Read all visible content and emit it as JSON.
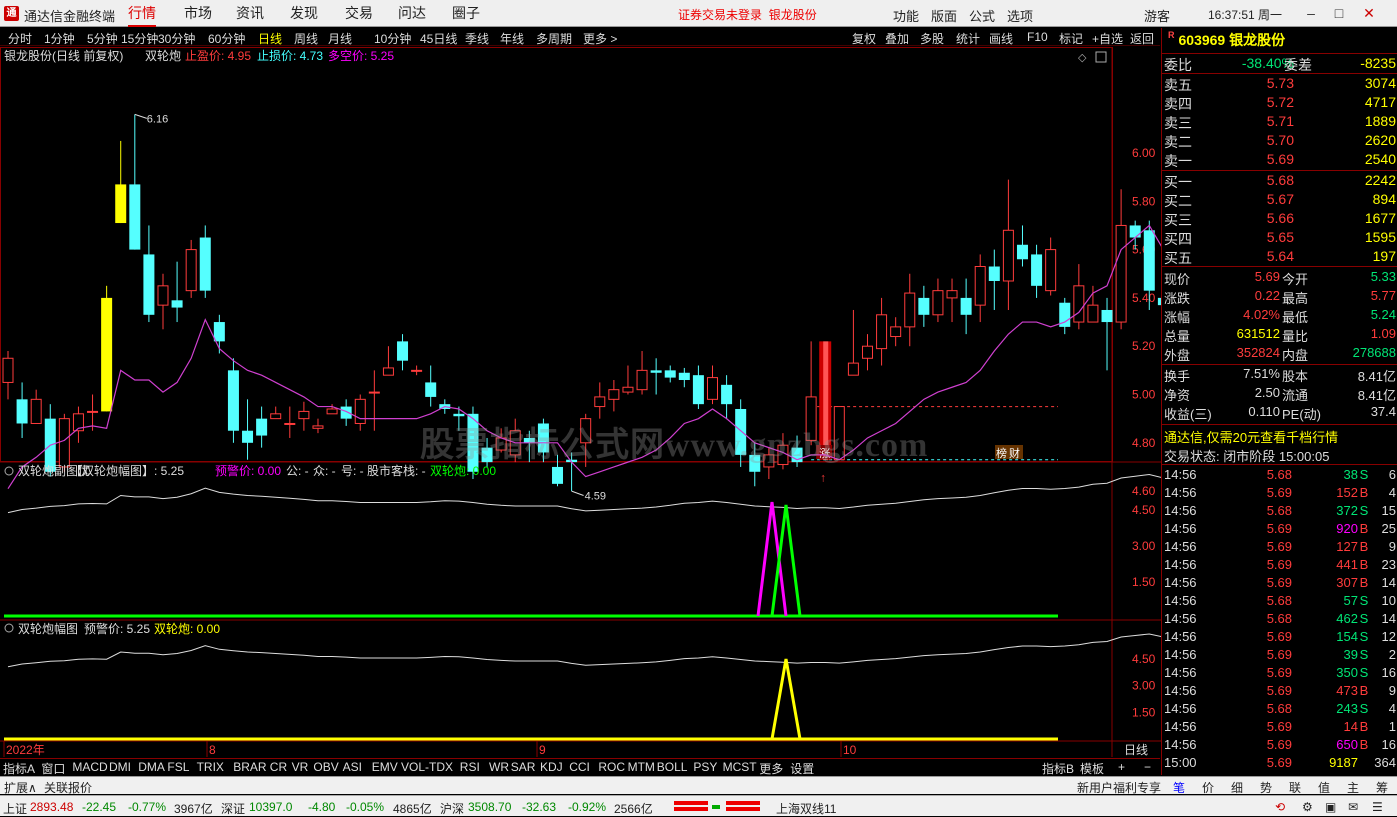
{
  "titlebar": {
    "app": "通达信金融终端",
    "menus": [
      "行情",
      "市场",
      "资讯",
      "发现",
      "交易",
      "问达",
      "圈子"
    ],
    "active": "行情",
    "notice": "证券交易未登录",
    "notice_stock": "银龙股份",
    "right_menus": [
      "功能",
      "版面",
      "公式",
      "选项"
    ],
    "user": "游客",
    "clock": "16:37:51 周一",
    "win_buttons": [
      "–",
      "□",
      "✕"
    ]
  },
  "toolbar": {
    "periods": [
      "分时",
      "1分钟",
      "5分钟",
      "15分钟",
      "30分钟",
      "60分钟",
      "日线",
      "周线",
      "月线",
      "10分钟",
      "45日线",
      "季线",
      "年线",
      "多周期",
      "更多 >"
    ],
    "active_period": "日线",
    "buttons": [
      "复权",
      "叠加",
      "多股",
      "统计",
      "画线",
      "F10",
      "标记",
      "+自选",
      "返回"
    ]
  },
  "main_chart": {
    "title": "银龙股份(日线 前复权)",
    "indicator": "双轮炮",
    "stop_profit_label": "止盈价: 4.95",
    "stop_loss_label": "止损价: 4.73",
    "long_short_label": "多空价: 5.25",
    "high_marker": "6.16",
    "low_marker": "4.59",
    "badge_zhang": "涨",
    "badge_bang": "榜",
    "badge_cai": "财",
    "watermark": "股票指标公式网www.gpzbgs.com",
    "y_labels": [
      "6.00",
      "5.80",
      "5.60",
      "5.40",
      "5.20",
      "5.00",
      "4.80",
      "4.60"
    ],
    "candles": [
      [
        5.05,
        5.15,
        4.98,
        5.18
      ],
      [
        4.98,
        4.88,
        4.82,
        5.05
      ],
      [
        4.88,
        4.98,
        4.9,
        5.02
      ],
      [
        4.9,
        4.68,
        4.66,
        4.96
      ],
      [
        4.7,
        4.9,
        4.68,
        4.92
      ],
      [
        4.85,
        4.92,
        4.8,
        4.95
      ],
      [
        4.93,
        4.93,
        4.85,
        5.0
      ],
      [
        4.93,
        5.4,
        4.93,
        5.45
      ],
      [
        5.71,
        5.87,
        5.71,
        6.05
      ],
      [
        5.87,
        5.6,
        5.6,
        6.16
      ],
      [
        5.58,
        5.33,
        5.3,
        5.7
      ],
      [
        5.37,
        5.45,
        5.27,
        5.5
      ],
      [
        5.39,
        5.36,
        5.3,
        5.55
      ],
      [
        5.43,
        5.6,
        5.4,
        5.64
      ],
      [
        5.65,
        5.43,
        5.4,
        5.7
      ],
      [
        5.3,
        5.22,
        5.17,
        5.33
      ],
      [
        5.1,
        4.85,
        4.8,
        5.15
      ],
      [
        4.85,
        4.8,
        4.73,
        4.98
      ],
      [
        4.9,
        4.83,
        4.78,
        4.95
      ],
      [
        4.9,
        4.92,
        4.9,
        4.95
      ],
      [
        4.88,
        4.88,
        4.82,
        4.95
      ],
      [
        4.9,
        4.93,
        4.85,
        4.97
      ],
      [
        4.86,
        4.87,
        4.84,
        4.9
      ],
      [
        4.92,
        4.94,
        4.92,
        4.96
      ],
      [
        4.95,
        4.9,
        4.87,
        4.98
      ],
      [
        4.88,
        4.98,
        4.85,
        5.0
      ],
      [
        5.01,
        5.01,
        4.85,
        5.1
      ],
      [
        5.08,
        5.11,
        5.08,
        5.2
      ],
      [
        5.22,
        5.14,
        5.1,
        5.25
      ],
      [
        5.1,
        5.1,
        5.08,
        5.12
      ],
      [
        5.05,
        4.99,
        4.95,
        5.12
      ],
      [
        4.96,
        4.94,
        4.92,
        4.98
      ],
      [
        4.92,
        4.91,
        4.85,
        4.95
      ],
      [
        4.92,
        4.68,
        4.65,
        4.95
      ],
      [
        4.78,
        4.72,
        4.7,
        4.82
      ],
      [
        4.77,
        4.82,
        4.76,
        4.86
      ],
      [
        4.75,
        4.85,
        4.72,
        4.9
      ],
      [
        4.82,
        4.8,
        4.72,
        4.85
      ],
      [
        4.88,
        4.76,
        4.72,
        4.9
      ],
      [
        4.7,
        4.63,
        4.62,
        4.75
      ],
      [
        4.73,
        4.72,
        4.6,
        4.76
      ],
      [
        4.8,
        4.9,
        4.7,
        4.92
      ],
      [
        4.95,
        4.99,
        4.9,
        5.05
      ],
      [
        4.98,
        5.02,
        4.93,
        5.06
      ],
      [
        5.01,
        5.03,
        5.0,
        5.12
      ],
      [
        5.02,
        5.1,
        5.0,
        5.18
      ],
      [
        5.1,
        5.09,
        5.0,
        5.15
      ],
      [
        5.1,
        5.07,
        5.05,
        5.12
      ],
      [
        5.09,
        5.06,
        5.03,
        5.11
      ],
      [
        5.08,
        4.96,
        4.94,
        5.12
      ],
      [
        4.98,
        5.07,
        4.96,
        5.12
      ],
      [
        5.04,
        4.96,
        4.9,
        5.08
      ],
      [
        4.94,
        4.75,
        4.7,
        4.98
      ],
      [
        4.75,
        4.68,
        4.62,
        4.8
      ],
      [
        4.7,
        4.75,
        4.65,
        4.78
      ],
      [
        4.71,
        4.79,
        4.69,
        4.84
      ],
      [
        4.78,
        4.72,
        4.7,
        4.83
      ],
      [
        4.81,
        4.99,
        4.79,
        5.22
      ],
      [
        4.93,
        4.83,
        4.73,
        4.96
      ],
      [
        4.73,
        4.95,
        4.73,
        4.95
      ],
      [
        5.08,
        5.13,
        5.08,
        5.35
      ],
      [
        5.15,
        5.2,
        5.1,
        5.25
      ],
      [
        5.19,
        5.33,
        5.12,
        5.4
      ],
      [
        5.24,
        5.28,
        5.2,
        5.32
      ],
      [
        5.28,
        5.42,
        5.2,
        5.5
      ],
      [
        5.4,
        5.33,
        5.28,
        5.45
      ],
      [
        5.33,
        5.43,
        5.3,
        5.48
      ],
      [
        5.4,
        5.43,
        5.3,
        5.48
      ],
      [
        5.4,
        5.33,
        5.25,
        5.48
      ],
      [
        5.37,
        5.53,
        5.3,
        5.58
      ],
      [
        5.53,
        5.47,
        5.35,
        5.6
      ],
      [
        5.47,
        5.68,
        5.35,
        5.89
      ],
      [
        5.62,
        5.56,
        5.53,
        5.7
      ],
      [
        5.58,
        5.45,
        5.4,
        5.62
      ],
      [
        5.43,
        5.6,
        5.41,
        5.65
      ],
      [
        5.38,
        5.28,
        5.25,
        5.4
      ],
      [
        5.3,
        5.45,
        5.27,
        5.54
      ],
      [
        5.3,
        5.37,
        5.32,
        5.45
      ],
      [
        5.35,
        5.3,
        5.1,
        5.4
      ],
      [
        5.3,
        5.7,
        5.27,
        5.85
      ],
      [
        5.7,
        5.65,
        5.6,
        5.72
      ],
      [
        5.68,
        5.43,
        5.35,
        5.72
      ],
      [
        5.4,
        5.37,
        5.3,
        5.85
      ],
      [
        5.3,
        5.32,
        5.28,
        5.45
      ],
      [
        5.33,
        5.68,
        5.25,
        5.77
      ]
    ],
    "line": [
      4.61,
      4.7,
      4.74,
      4.79,
      4.81,
      4.86,
      4.87,
      4.86,
      5.1,
      5.06,
      5.06,
      5.01,
      5.05,
      5.15,
      5.31,
      5.19,
      5.14,
      5.1,
      5.08,
      5.05,
      5.02,
      4.99,
      4.95,
      4.95,
      4.93,
      4.9,
      4.9,
      4.9,
      4.9,
      4.9,
      4.92,
      4.95,
      4.94,
      4.9,
      4.85,
      4.82,
      4.8,
      4.8,
      4.8,
      4.8,
      4.72,
      4.66,
      4.68,
      4.7,
      4.72,
      4.74,
      4.77,
      4.82,
      4.88,
      4.9,
      4.94,
      4.9,
      4.85,
      4.8,
      4.78,
      4.76,
      4.73,
      4.75,
      4.75,
      4.73,
      4.77,
      4.82,
      4.85,
      4.88,
      4.93,
      4.98,
      5.01,
      5.03,
      5.05,
      5.1,
      5.18,
      5.25,
      5.3,
      5.3,
      5.28,
      5.3,
      5.34,
      5.42,
      5.45,
      5.6,
      5.65,
      5.7,
      5.6,
      5.28,
      5.26,
      5.26
    ],
    "stop_profit_line": 4.95,
    "stop_loss_line": 4.73
  },
  "sub1": {
    "title": "双轮炮副图优",
    "formula": "【双轮炮幅图】: 5.25",
    "warn": "预警价: 0.00",
    "public": "公: -",
    "crowd": "众: -",
    "num": "号: -",
    "stock": "股市客栈: -",
    "dlp": "双轮炮: 0.00",
    "y_labels": [
      "4.50",
      "3.00",
      "1.50"
    ]
  },
  "sub2": {
    "title": "双轮炮幅图",
    "warn": "预警价: 5.25",
    "dlp": "双轮炮: 0.00",
    "y_labels": [
      "4.50",
      "3.00",
      "1.50"
    ],
    "x_labels": [
      "2022年",
      "8",
      "9",
      "10"
    ],
    "period_label": "日线"
  },
  "right_panel": {
    "code": "603969",
    "name": "银龙股份",
    "wb_label": "委比",
    "wb": "-38.40%",
    "wc_label": "委差",
    "wc": "-8235",
    "asks": [
      {
        "l": "卖五",
        "p": "5.73",
        "v": "3074"
      },
      {
        "l": "卖四",
        "p": "5.72",
        "v": "4717"
      },
      {
        "l": "卖三",
        "p": "5.71",
        "v": "1889"
      },
      {
        "l": "卖二",
        "p": "5.70",
        "v": "2620"
      },
      {
        "l": "卖一",
        "p": "5.69",
        "v": "2540"
      }
    ],
    "bids": [
      {
        "l": "买一",
        "p": "5.68",
        "v": "2242"
      },
      {
        "l": "买二",
        "p": "5.67",
        "v": "894"
      },
      {
        "l": "买三",
        "p": "5.66",
        "v": "1677"
      },
      {
        "l": "买四",
        "p": "5.65",
        "v": "1595"
      },
      {
        "l": "买五",
        "p": "5.64",
        "v": "197"
      }
    ],
    "quote": [
      {
        "k1": "现价",
        "v1": "5.69",
        "c1": "red",
        "k2": "今开",
        "v2": "5.33",
        "c2": "grn"
      },
      {
        "k1": "涨跌",
        "v1": "0.22",
        "c1": "red",
        "k2": "最高",
        "v2": "5.77",
        "c2": "red"
      },
      {
        "k1": "涨幅",
        "v1": "4.02%",
        "c1": "red",
        "k2": "最低",
        "v2": "5.24",
        "c2": "grn"
      },
      {
        "k1": "总量",
        "v1": "631512",
        "c1": "yel",
        "k2": "量比",
        "v2": "1.09",
        "c2": "red"
      },
      {
        "k1": "外盘",
        "v1": "352824",
        "c1": "red",
        "k2": "内盘",
        "v2": "278688",
        "c2": "grn"
      }
    ],
    "quote2": [
      {
        "k1": "换手",
        "v1": "7.51%",
        "k2": "股本",
        "v2": "8.41亿"
      },
      {
        "k1": "净资",
        "v1": "2.50",
        "k2": "流通",
        "v2": "8.41亿"
      },
      {
        "k1": "收益(三)",
        "v1": "0.110",
        "k2": "PE(动)",
        "v2": "37.4"
      }
    ],
    "promo": "通达信,仅需20元查看千档行情",
    "state": "交易状态: 闭市阶段 15:00:05",
    "ticks": [
      [
        "14:56",
        "5.68",
        "38",
        "S",
        "6"
      ],
      [
        "14:56",
        "5.69",
        "152",
        "B",
        "4"
      ],
      [
        "14:56",
        "5.68",
        "372",
        "S",
        "15"
      ],
      [
        "14:56",
        "5.69",
        "920",
        "B",
        "25"
      ],
      [
        "14:56",
        "5.69",
        "127",
        "B",
        "9"
      ],
      [
        "14:56",
        "5.69",
        "441",
        "B",
        "23"
      ],
      [
        "14:56",
        "5.69",
        "307",
        "B",
        "14"
      ],
      [
        "14:56",
        "5.68",
        "57",
        "S",
        "10"
      ],
      [
        "14:56",
        "5.68",
        "462",
        "S",
        "14"
      ],
      [
        "14:56",
        "5.69",
        "154",
        "S",
        "12"
      ],
      [
        "14:56",
        "5.69",
        "39",
        "S",
        "2"
      ],
      [
        "14:56",
        "5.69",
        "350",
        "S",
        "16"
      ],
      [
        "14:56",
        "5.69",
        "473",
        "B",
        "9"
      ],
      [
        "14:56",
        "5.68",
        "243",
        "S",
        "4"
      ],
      [
        "14:56",
        "5.69",
        "14",
        "B",
        "1"
      ],
      [
        "14:56",
        "5.69",
        "650",
        "B",
        "16"
      ],
      [
        "15:00",
        "5.69",
        "9187",
        "",
        "364"
      ]
    ],
    "bottom_tabs": [
      "笔",
      "价",
      "细",
      "势",
      "联",
      "值",
      "主",
      "筹"
    ]
  },
  "ind_tabs": [
    "指标A",
    "窗口",
    "MACD",
    "DMI",
    "DMA",
    "FSL",
    "TRIX",
    "BRAR",
    "CR",
    "VR",
    "OBV",
    "ASI",
    "EMV",
    "VOL-TDX",
    "RSI",
    "WR",
    "SAR",
    "KDJ",
    "CCI",
    "ROC",
    "MTM",
    "BOLL",
    "PSY",
    "MCST",
    "更多",
    "设置"
  ],
  "ind_right": [
    "指标B",
    "模板",
    "+",
    "−"
  ],
  "bottom_bar": {
    "left": "扩展∧",
    "left2": "关联报价",
    "right": "新用户福利专享"
  },
  "status": {
    "sh_label": "上证",
    "sh": "2893.48",
    "sh_chg": "-22.45",
    "sh_pct": "-0.77%",
    "sh_amt": "3967亿",
    "sz_label": "深证",
    "sz": "10397.0",
    "sz_chg": "-4.80",
    "sz_pct": "-0.05%",
    "sz_amt": "4865亿",
    "hs_label": "沪深",
    "hs": "3508.70",
    "hs_chg": "-32.63",
    "hs_pct": "-0.92%",
    "hs_amt": "2566亿",
    "line": "上海双线11"
  }
}
